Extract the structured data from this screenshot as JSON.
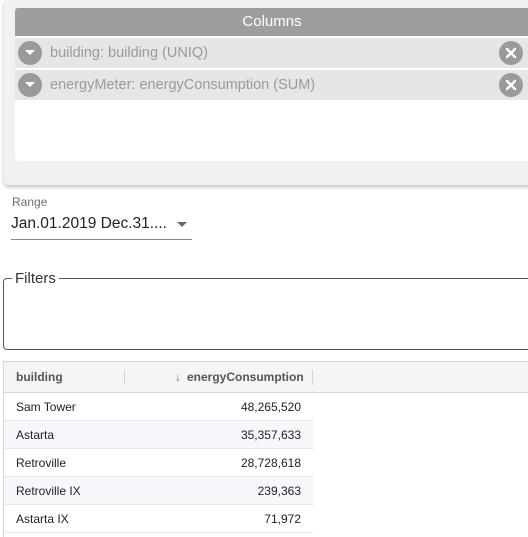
{
  "columns": {
    "title": "Columns",
    "items": [
      {
        "label": "building: building (UNIQ)"
      },
      {
        "label": "energyMeter: energyConsumption (SUM)"
      }
    ]
  },
  "range": {
    "label": "Range",
    "value": "Jan.01.2019 Dec.31...."
  },
  "filters": {
    "legend": "Filters"
  },
  "table": {
    "headers": {
      "building": "building",
      "energy": "energyConsumption",
      "sort_icon": "↓"
    },
    "rows": [
      {
        "building": "Sam Tower",
        "energy": "48,265,520"
      },
      {
        "building": "Astarta",
        "energy": "35,357,633"
      },
      {
        "building": "Retroville",
        "energy": "28,728,618"
      },
      {
        "building": "Retroville IX",
        "energy": "239,363"
      },
      {
        "building": "Astarta IX",
        "energy": "71,972"
      }
    ]
  },
  "colors": {
    "chip_icon": "#9a9a9a",
    "header_bar": "#9e9e9e"
  }
}
